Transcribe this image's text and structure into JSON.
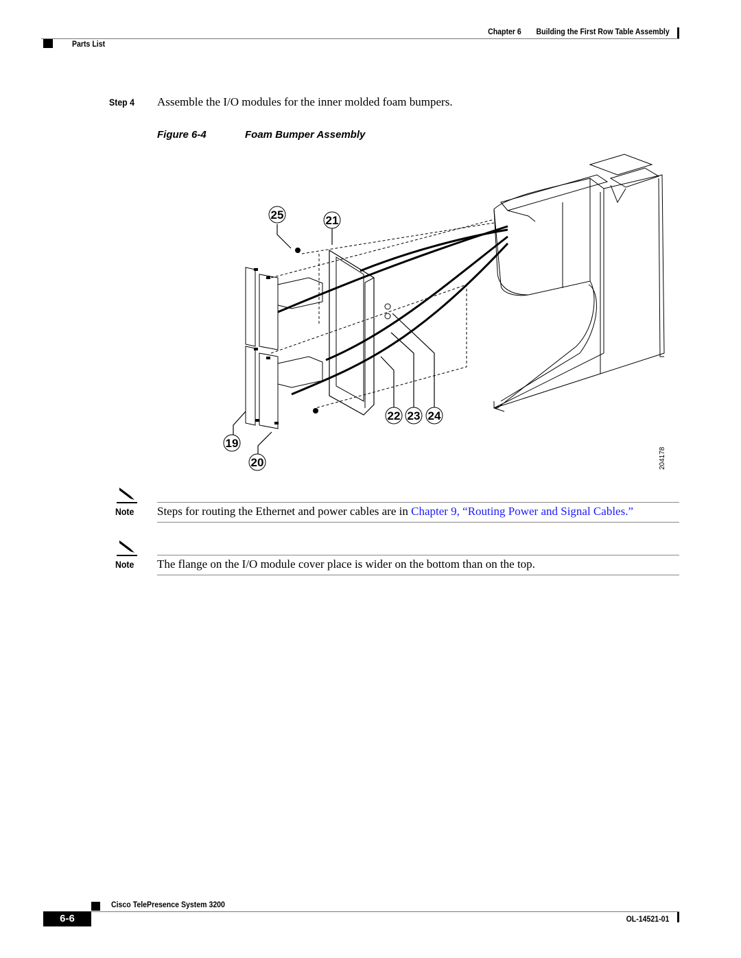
{
  "header": {
    "chapter": "Chapter 6",
    "chapter_title": "Building the First Row Table Assembly",
    "section": "Parts List"
  },
  "step": {
    "label": "Step 4",
    "text": "Assemble the I/O modules for the inner molded foam bumpers."
  },
  "figure": {
    "number": "Figure 6-4",
    "title": "Foam Bumper Assembly",
    "callouts": [
      "25",
      "21",
      "22",
      "23",
      "24",
      "19",
      "20"
    ],
    "art_id": "204178"
  },
  "notes": [
    {
      "label": "Note",
      "icon": "pencil-note-icon",
      "text": "Steps for routing the Ethernet and power cables are in ",
      "link": "Chapter 9, “Routing Power and Signal Cables.”"
    },
    {
      "label": "Note",
      "icon": "pencil-note-icon",
      "text": "The flange on the I/O module cover place is wider on the bottom than on the top."
    }
  ],
  "footer": {
    "product": "Cisco TelePresence System 3200",
    "page": "6-6",
    "doc_id": "OL-14521-01"
  },
  "colors": {
    "link": "#1a1aff"
  }
}
